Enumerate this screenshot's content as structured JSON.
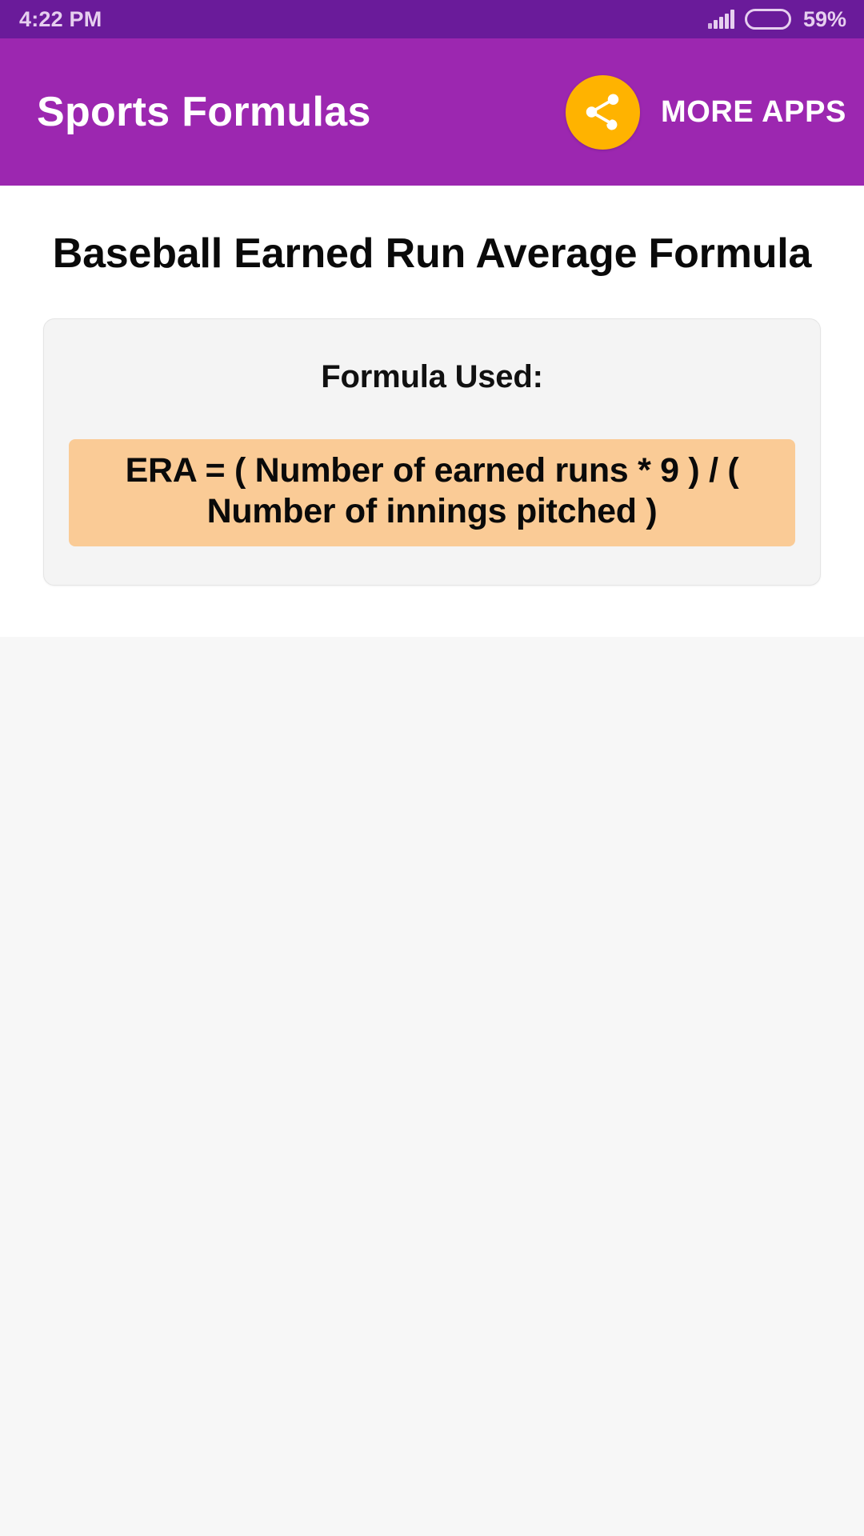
{
  "status_bar": {
    "time": "4:22 PM",
    "battery_percent_label": "59%",
    "battery_level": 59,
    "signal_icon": "signal-bars-icon",
    "battery_icon": "battery-icon",
    "background_color": "#6A1B9A",
    "foreground_color": "#E6CFEF"
  },
  "app_bar": {
    "title": "Sports Formulas",
    "share_icon": "share-icon",
    "share_button_color": "#FFB300",
    "more_apps_label": "MORE APPS",
    "background_color": "#9C27B0",
    "text_color": "#FFFFFF"
  },
  "main": {
    "page_title": "Baseball Earned Run Average Formula",
    "card": {
      "formula_used_label": "Formula Used:",
      "formula_text": "ERA = ( Number of earned runs * 9 ) / ( Number of innings pitched )",
      "formula_box_color": "#FACB96",
      "card_background_color": "#F4F4F4"
    }
  }
}
